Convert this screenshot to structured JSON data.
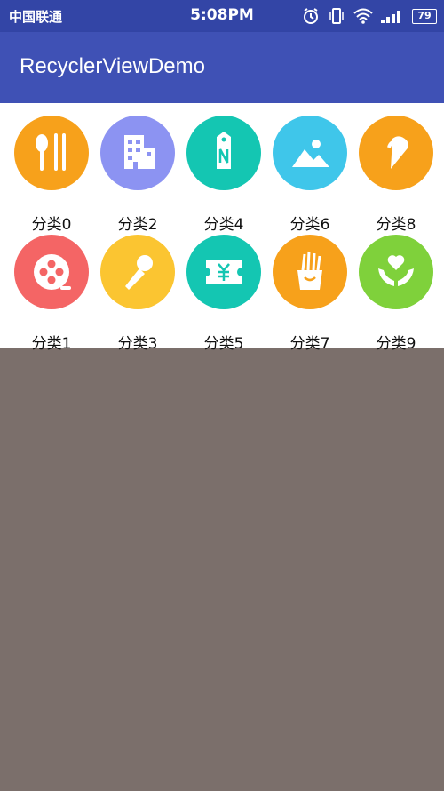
{
  "status_bar": {
    "carrier": "中国联通",
    "time": "5:08PM",
    "battery": "79"
  },
  "app_bar": {
    "title": "RecyclerViewDemo"
  },
  "categories": [
    {
      "label": "分类0",
      "icon": "utensils-icon",
      "color": "#f7a11b"
    },
    {
      "label": "分类1",
      "icon": "film-reel-icon",
      "color": "#f46565"
    },
    {
      "label": "分类2",
      "icon": "building-icon",
      "color": "#8c93f2"
    },
    {
      "label": "分类3",
      "icon": "microphone-icon",
      "color": "#fbc531"
    },
    {
      "label": "分类4",
      "icon": "price-tag-icon",
      "color": "#14c6b2"
    },
    {
      "label": "分类5",
      "icon": "ticket-icon",
      "color": "#14c6b2"
    },
    {
      "label": "分类6",
      "icon": "landscape-photo-icon",
      "color": "#3fc6ea"
    },
    {
      "label": "分类7",
      "icon": "fries-icon",
      "color": "#f7a11b"
    },
    {
      "label": "分类8",
      "icon": "ice-cream-icon",
      "color": "#f7a11b"
    },
    {
      "label": "分类9",
      "icon": "heart-hands-icon",
      "color": "#7fd13b"
    }
  ]
}
